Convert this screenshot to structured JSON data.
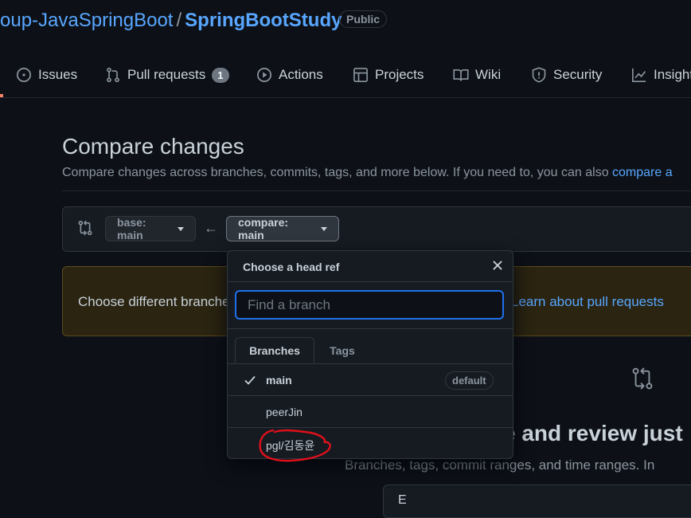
{
  "repo": {
    "owner": "oup-JavaSpringBoot",
    "separator": "/",
    "name": "SpringBootStudy",
    "visibility": "Public"
  },
  "nav": {
    "items": [
      {
        "label": "Issues",
        "icon": "issue-icon"
      },
      {
        "label": "Pull requests",
        "icon": "pull-request-icon",
        "count": "1"
      },
      {
        "label": "Actions",
        "icon": "play-icon"
      },
      {
        "label": "Projects",
        "icon": "table-icon"
      },
      {
        "label": "Wiki",
        "icon": "book-icon"
      },
      {
        "label": "Security",
        "icon": "shield-icon"
      },
      {
        "label": "Insights",
        "icon": "graph-icon"
      }
    ]
  },
  "compare": {
    "title": "Compare changes",
    "subtitle": "Compare changes across branches, commits, tags, and more below. If you need to, you can also ",
    "subtitle_link": "compare a",
    "base_label": "base: main",
    "compare_label": "compare: main"
  },
  "flash": {
    "text": "Choose different branche",
    "link": "Learn about pull requests"
  },
  "blankslate": {
    "title": "e and review just",
    "subtitle": "Branches, tags, commit ranges, and time ranges. In",
    "example": "E"
  },
  "dropdown": {
    "title": "Choose a head ref",
    "search_placeholder": "Find a branch",
    "tabs": {
      "branches": "Branches",
      "tags": "Tags"
    },
    "items": [
      {
        "label": "main",
        "selected": true,
        "badge": "default"
      },
      {
        "label": "peerJin"
      },
      {
        "label": "pgl/김동윤"
      }
    ]
  },
  "colors": {
    "accent": "#58a6ff",
    "annotation": "#e0101a",
    "background": "#0d1117"
  }
}
